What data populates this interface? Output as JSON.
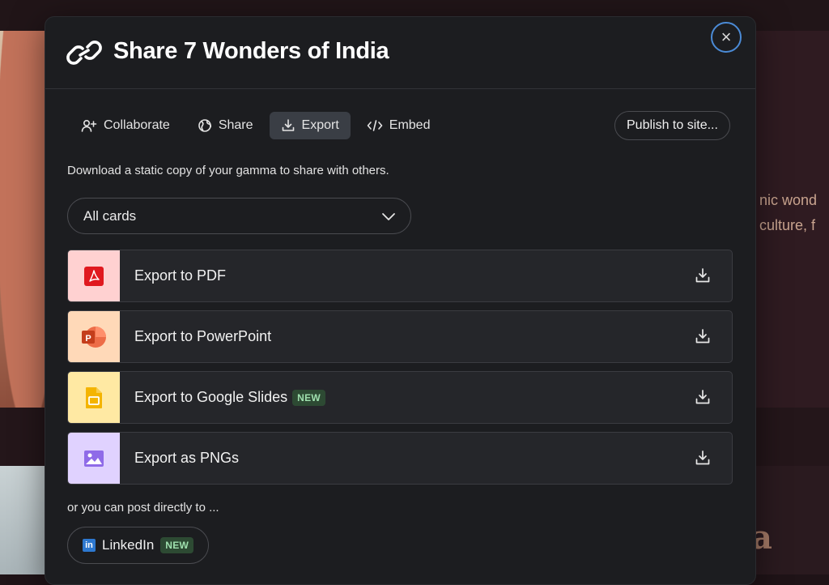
{
  "background": {
    "text_line_1": "nic wond",
    "text_line_2": "culture, f",
    "big_letter": "a"
  },
  "modal": {
    "title": "Share 7 Wonders of India",
    "close_symbol": "×",
    "icons": {
      "title": "link-icon",
      "close": "close-icon"
    }
  },
  "tabs": [
    {
      "label": "Collaborate",
      "icon": "add-person-icon",
      "active": false
    },
    {
      "label": "Share",
      "icon": "globe-icon",
      "active": false
    },
    {
      "label": "Export",
      "icon": "download-icon",
      "active": true
    },
    {
      "label": "Embed",
      "icon": "code-icon",
      "active": false
    }
  ],
  "publish_button": "Publish to site...",
  "description": "Download a static copy of your gamma to share with others.",
  "cards_select": {
    "value": "All cards",
    "icon": "chevron-down-icon"
  },
  "export_options": [
    {
      "label": "Export to PDF",
      "icon": "pdf-icon",
      "color": "#ffd1d1",
      "badge": ""
    },
    {
      "label": "Export to PowerPoint",
      "icon": "powerpoint-icon",
      "color": "#ffd9b8",
      "badge": ""
    },
    {
      "label": "Export to Google Slides",
      "icon": "google-slides-icon",
      "color": "#ffe9a3",
      "badge": "NEW"
    },
    {
      "label": "Export as PNGs",
      "icon": "image-icon",
      "color": "#e0d2ff",
      "badge": ""
    }
  ],
  "post_text": "or you can post directly to ...",
  "linkedin": {
    "label": "LinkedIn",
    "logo": "in",
    "badge": "NEW"
  },
  "colors": {
    "accent_focus": "#4b8bd6",
    "badge_bg": "#2d4a33",
    "badge_text": "#9fe0ae"
  }
}
